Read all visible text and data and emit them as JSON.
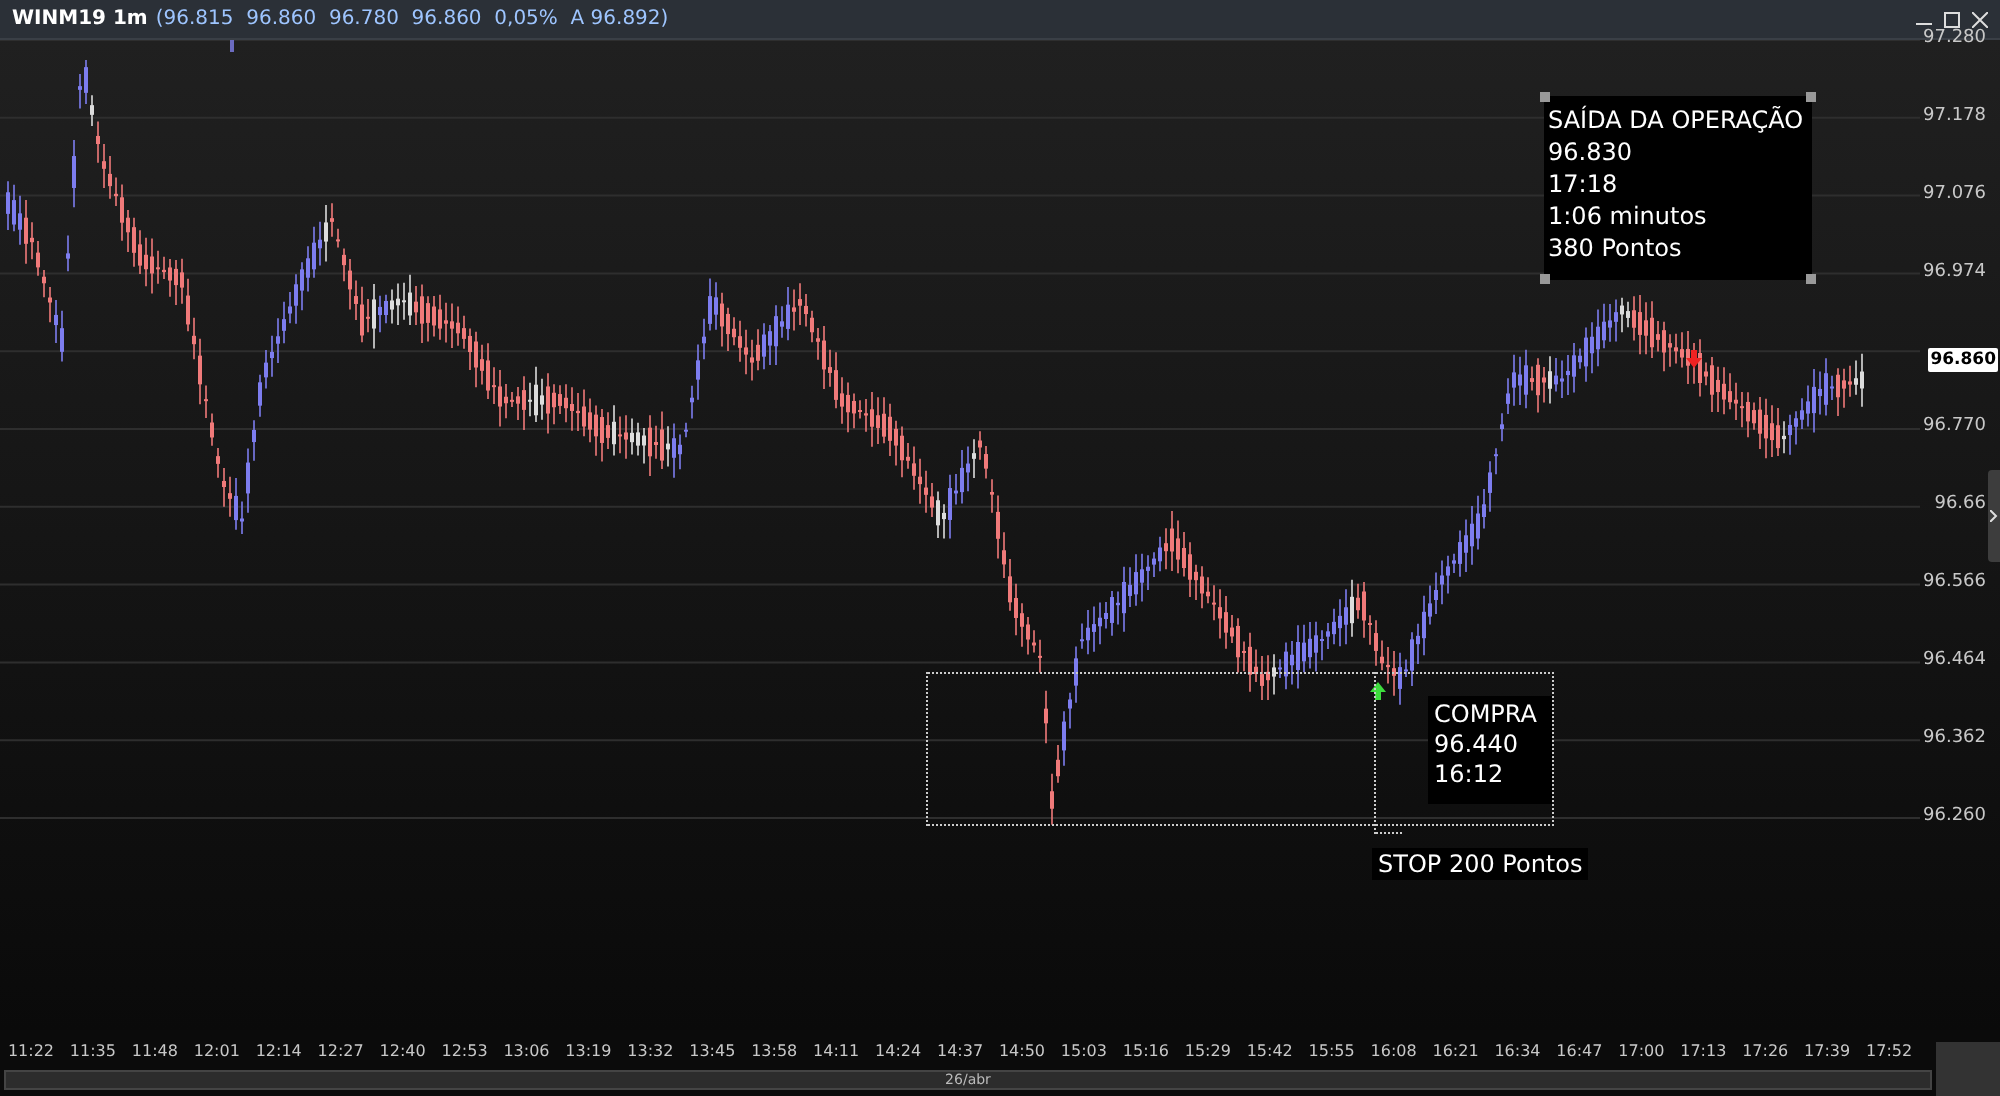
{
  "header": {
    "symbol": "WINM19 1m",
    "quote": "(96.815  96.860  96.780  96.860  0,05%  A 96.892)"
  },
  "y_axis": {
    "ticks_above": [
      "97.280",
      "97.178",
      "97.076",
      "96.974"
    ],
    "last_price": "96.860",
    "ticks_below": [
      "96.770",
      "96.66",
      "96.566",
      "96.464",
      "96.362",
      "96.260"
    ]
  },
  "x_axis": {
    "ticks": [
      "11:22",
      "11:35",
      "11:48",
      "12:01",
      "12:14",
      "12:27",
      "12:40",
      "12:53",
      "13:06",
      "13:19",
      "13:32",
      "13:45",
      "13:58",
      "14:11",
      "14:24",
      "14:37",
      "14:50",
      "15:03",
      "15:16",
      "15:29",
      "15:42",
      "15:55",
      "16:08",
      "16:21",
      "16:34",
      "16:47",
      "17:00",
      "17:13",
      "17:26",
      "17:39",
      "17:52"
    ],
    "date": "26/abr"
  },
  "annotations": [
    {
      "kind": "exit",
      "lines": [
        "SAÍDA DA OPERAÇÃO",
        "96.830",
        "17:18",
        "1:06 minutos",
        "380 Pontos"
      ]
    },
    {
      "kind": "entry",
      "lines": [
        "COMPRA",
        "96.440",
        "16:12"
      ]
    },
    {
      "kind": "stop",
      "lines": [
        "STOP 200 Pontos"
      ]
    }
  ]
}
